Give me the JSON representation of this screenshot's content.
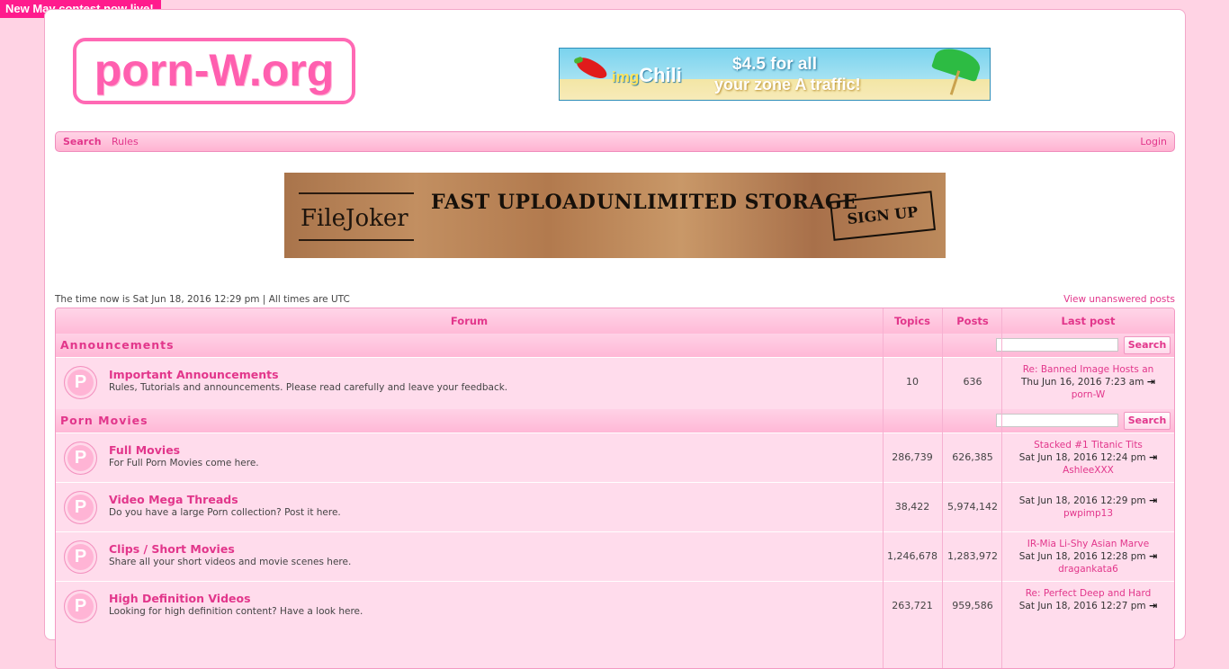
{
  "topbar": {
    "contest": "New May contest now live!"
  },
  "header": {
    "logo": "porn-W.org"
  },
  "ad1": {
    "brand_prefix": "img",
    "brand": "Chili",
    "price": "$4.5",
    "price_suffix": " for all",
    "sub": "your zone A traffic!"
  },
  "nav": {
    "search": "Search",
    "rules": "Rules",
    "login": "Login"
  },
  "ad2": {
    "brand": "FileJoker",
    "fast": "FAST UPLOAD",
    "unlimited": "UNLIMITED STORAGE",
    "signup": "SIGN UP"
  },
  "info": {
    "time": "The time now is Sat Jun 18, 2016 12:29 pm | All times are UTC",
    "unanswered": "View unanswered posts"
  },
  "table": {
    "headers": {
      "forum": "Forum",
      "topics": "Topics",
      "posts": "Posts",
      "last_post": "Last post"
    },
    "search_label": "Search",
    "categories": [
      {
        "title": "Announcements"
      },
      {
        "title": "Porn Movies"
      }
    ],
    "rows": [
      {
        "icon": "P",
        "title": "Important Announcements",
        "desc": "Rules, Tutorials and announcements. Please read carefully and leave your feedback.",
        "topics": "10",
        "posts": "636",
        "last_title": "Re: Banned Image Hosts an",
        "last_date": "Thu Jun 16, 2016 7:23 am",
        "last_user": "porn-W"
      },
      {
        "icon": "P",
        "title": "Full Movies",
        "desc": "For Full Porn Movies come here.",
        "topics": "286,739",
        "posts": "626,385",
        "last_title": "Stacked #1 Titanic Tits",
        "last_date": "Sat Jun 18, 2016 12:24 pm",
        "last_user": "AshleeXXX"
      },
      {
        "icon": "P",
        "title": "Video Mega Threads",
        "desc": "Do you have a large Porn collection? Post it here.",
        "topics": "38,422",
        "posts": "5,974,142",
        "last_title": "",
        "last_date": "Sat Jun 18, 2016 12:29 pm",
        "last_user": "pwpimp13"
      },
      {
        "icon": "P",
        "title": "Clips / Short Movies",
        "desc": "Share all your short videos and movie scenes here.",
        "topics": "1,246,678",
        "posts": "1,283,972",
        "last_title": "IR-Mia Li-Shy Asian Marve",
        "last_date": "Sat Jun 18, 2016 12:28 pm",
        "last_user": "dragankata6"
      },
      {
        "icon": "P",
        "title": "High Definition Videos",
        "desc": "Looking for high definition content? Have a look here.",
        "topics": "263,721",
        "posts": "959,586",
        "last_title": "Re: Perfect Deep and Hard",
        "last_date": "Sat Jun 18, 2016 12:27 pm",
        "last_user": ""
      }
    ]
  }
}
